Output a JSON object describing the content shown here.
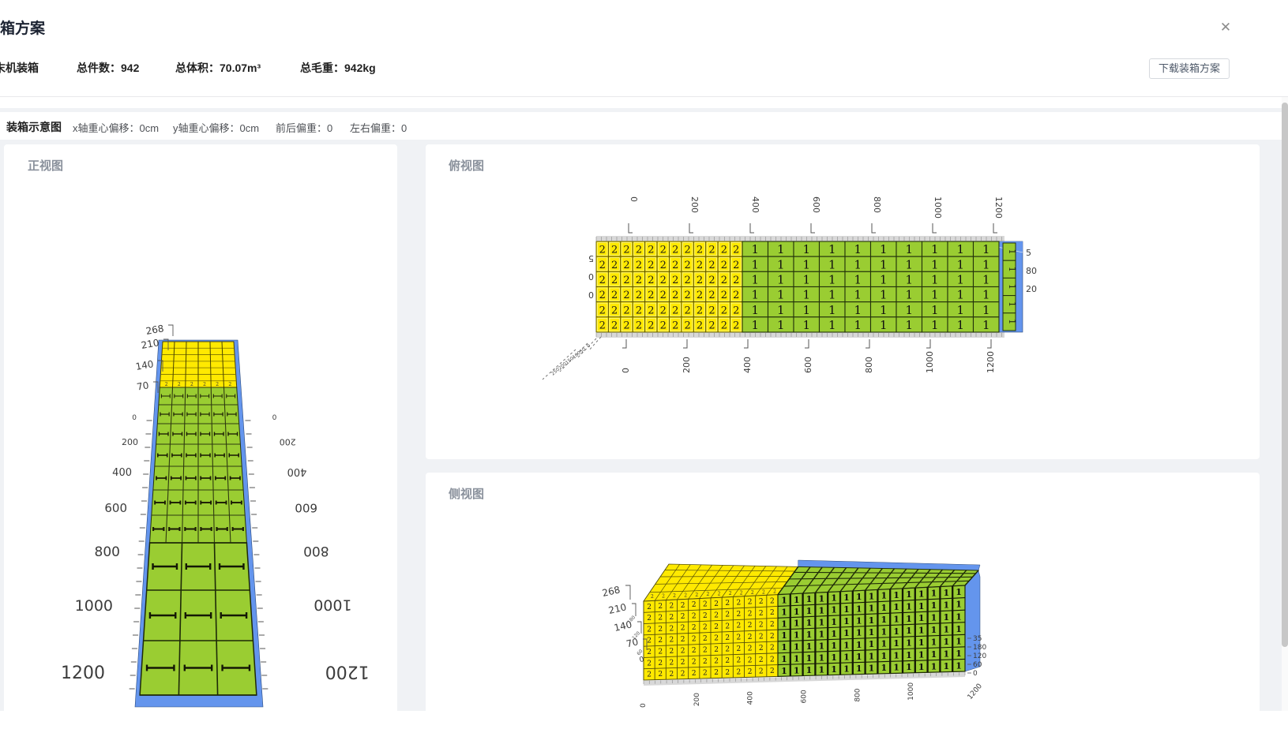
{
  "modal": {
    "title": "装箱方案",
    "close_label": "✕",
    "summary": {
      "scheme_label": "末机装箱",
      "items": [
        {
          "label": "总件数：",
          "value": "942"
        },
        {
          "label": "总体积：",
          "value": "70.07m³"
        },
        {
          "label": "总毛重：",
          "value": "942kg"
        }
      ],
      "download_button": "下载装箱方案"
    },
    "diagram_bar": {
      "title": "装箱示意图",
      "metrics": [
        {
          "label": "x轴重心偏移：",
          "value": "0cm"
        },
        {
          "label": "y轴重心偏移：",
          "value": "0cm"
        },
        {
          "label": "前后偏重：",
          "value": "0"
        },
        {
          "label": "左右偏重：",
          "value": "0"
        }
      ]
    }
  },
  "colors": {
    "box_green": "#9ACD32",
    "box_yellow": "#FFE900",
    "container_blue": "#6495ED",
    "grid_yellow": "#7a6f00",
    "grid_green": "#263309",
    "axis_text": "#3c3c3c",
    "ruler": "#d8d8d8"
  },
  "chart_data": [
    {
      "id": "front",
      "type": "heatmap",
      "title": "正视图",
      "view": "3d-container-front",
      "height_ticks": [
        "268",
        "210",
        "140",
        "70"
      ],
      "length_ticks": [
        "0",
        "200",
        "400",
        "600",
        "800",
        "1000",
        "1200"
      ],
      "far_box_label": "2",
      "near_box_label": "1",
      "layout": {
        "yellow_rows": 7,
        "green_small_rows": 7,
        "green_small_cols": 6,
        "green_large_rows": 3,
        "green_large_cols": 3
      }
    },
    {
      "id": "top",
      "type": "heatmap",
      "title": "俯视图",
      "view": "3d-container-top",
      "x_ticks_top": [
        "0",
        "200",
        "400",
        "600",
        "800",
        "1000",
        "1200"
      ],
      "x_ticks_bottom": [
        "0",
        "200",
        "400",
        "600",
        "800",
        "1000",
        "1200"
      ],
      "y_ticks_left": [
        "5",
        "0",
        "0"
      ],
      "y_ticks_right": [
        "5",
        "80",
        "20"
      ],
      "z_ticks_corner": [
        "0",
        "50",
        "100",
        "150",
        "200",
        "250"
      ],
      "yellow_region": {
        "cols": 12,
        "rows": 6,
        "label": "2"
      },
      "green_region": {
        "cols": 10,
        "rows": 6,
        "label": "1"
      }
    },
    {
      "id": "side",
      "type": "heatmap",
      "title": "侧视图",
      "view": "3d-container-side",
      "height_ticks": [
        "268",
        "210",
        "140",
        "70",
        "0"
      ],
      "depth_ticks_right": [
        "35",
        "180",
        "120",
        "60",
        "0"
      ],
      "depth_ticks_small": [
        "180",
        "120",
        "60"
      ],
      "x_ticks": [
        "0",
        "200",
        "400",
        "600",
        "800",
        "1000",
        "1200"
      ],
      "yellow_region": {
        "cols": 12,
        "rows": 7,
        "label": "2"
      },
      "green_region": {
        "cols": 15,
        "rows": 7,
        "label": "1"
      }
    }
  ]
}
